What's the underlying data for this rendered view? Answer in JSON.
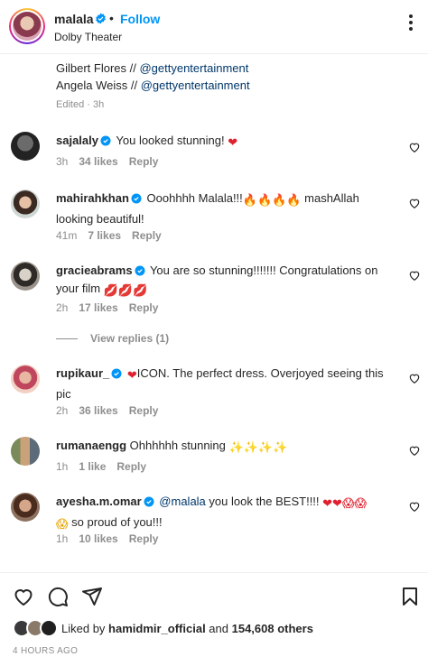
{
  "header": {
    "username": "malala",
    "separator": "•",
    "follow_label": "Follow",
    "location": "Dolby Theater"
  },
  "caption": {
    "lines": [
      {
        "name": "Gilbert Flores // ",
        "tag": "@gettyentertainment"
      },
      {
        "name": "Angela Weiss // ",
        "tag": "@gettyentertainment"
      }
    ],
    "edited": "Edited · 3h"
  },
  "comments": [
    {
      "username": "sajalaly",
      "verified": true,
      "text": "You looked stunning!",
      "emoji": "❤",
      "time": "3h",
      "likes": "34 likes",
      "reply": "Reply"
    },
    {
      "username": "mahirahkhan",
      "verified": true,
      "text": "Ooohhhh Malala!!!",
      "emoji": "🔥🔥🔥🔥",
      "text2": " mashAllah",
      "line2": "looking beautiful!",
      "time": "41m",
      "likes": "7 likes",
      "reply": "Reply"
    },
    {
      "username": "gracieabrams",
      "verified": true,
      "text": "You are so stunning!!!!!!! Congratulations on",
      "line2": "your film",
      "emoji": "💋💋💋",
      "time": "2h",
      "likes": "17 likes",
      "reply": "Reply",
      "view_replies": "View replies (1)"
    },
    {
      "username": "rupikaur_",
      "verified": true,
      "emoji": "❤",
      "text": "ICON. The perfect dress. Overjoyed seeing this",
      "line2": "pic",
      "time": "2h",
      "likes": "36 likes",
      "reply": "Reply"
    },
    {
      "username": "rumanaengg",
      "verified": false,
      "text": "Ohhhhhh stunning",
      "emoji": "✨✨✨✨",
      "time": "1h",
      "likes": "1 like",
      "reply": "Reply"
    },
    {
      "username": "ayesha.m.omar",
      "verified": true,
      "mention": "@malala",
      "text": " you look the BEST!!!!",
      "emoji": "❤❤😱😱",
      "line2_emoji": "😱",
      "line2": " so proud of you!!!",
      "time": "1h",
      "likes": "10 likes",
      "reply": "Reply"
    }
  ],
  "actions": {
    "icons": [
      "heart-icon",
      "comment-icon",
      "share-icon",
      "bookmark-icon"
    ]
  },
  "likes_summary": {
    "prefix": "Liked by ",
    "user": "hamidmir_official",
    "middle": " and ",
    "count": "154,608 others"
  },
  "timestamp": "4 HOURS AGO",
  "colors": {
    "link": "#0095f6",
    "mention": "#00376b",
    "muted": "#8e8e8e",
    "verified": "#0095f6",
    "heart": "#e0202f"
  }
}
